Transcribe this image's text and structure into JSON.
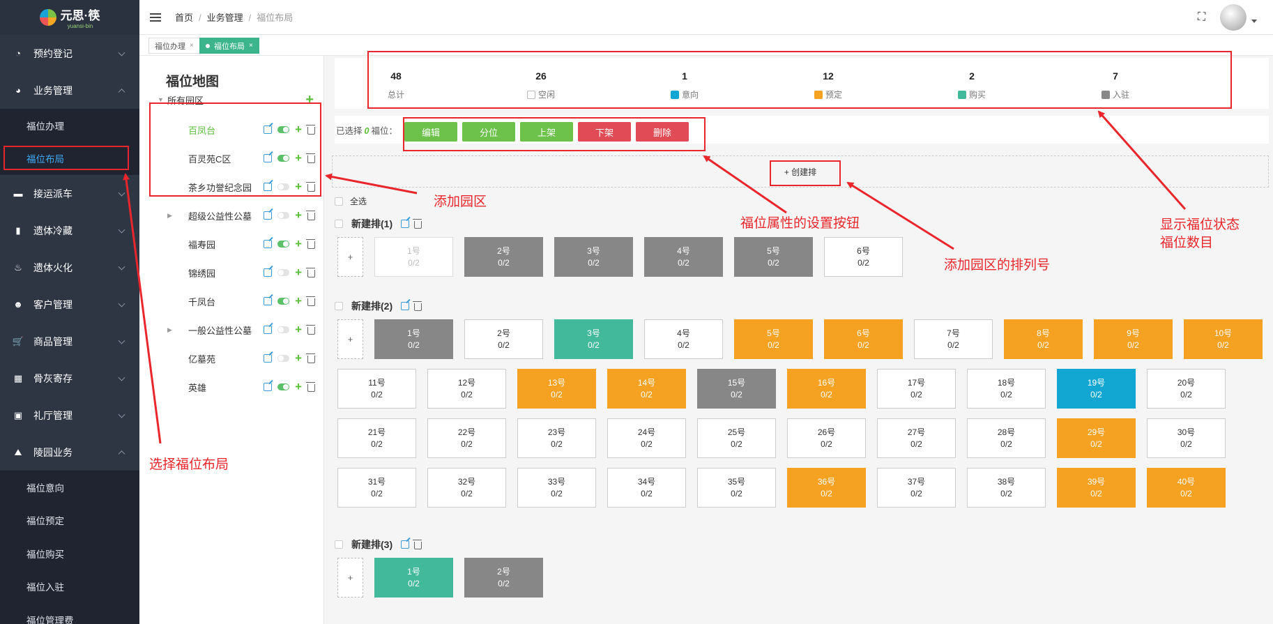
{
  "app": {
    "logo_text": "元思·筷",
    "logo_sub": "yuansi-bin"
  },
  "sidebar": {
    "items": [
      {
        "label": "预约登记",
        "icon": "dashboard-icon"
      },
      {
        "label": "业务管理",
        "icon": "chat-icon",
        "expanded": true,
        "children": [
          "福位办理",
          "福位布局"
        ],
        "active_child": "福位布局"
      },
      {
        "label": "接运派车",
        "icon": "truck-icon"
      },
      {
        "label": "遗体冷藏",
        "icon": "thermometer-icon"
      },
      {
        "label": "遗体火化",
        "icon": "fire-icon"
      },
      {
        "label": "客户管理",
        "icon": "users-icon"
      },
      {
        "label": "商品管理",
        "icon": "cart-icon"
      },
      {
        "label": "骨灰寄存",
        "icon": "grid-icon"
      },
      {
        "label": "礼厅管理",
        "icon": "hall-icon"
      },
      {
        "label": "陵园业务",
        "icon": "cemetery-icon",
        "expanded": true,
        "children": [
          "福位意向",
          "福位预定",
          "福位购买",
          "福位入驻",
          "福位管理费"
        ]
      }
    ]
  },
  "topbar": {
    "breadcrumb": [
      "首页",
      "业务管理",
      "福位布局"
    ]
  },
  "tabs": [
    {
      "label": "福位办理",
      "active": false
    },
    {
      "label": "福位布局",
      "active": true
    }
  ],
  "leftpanel": {
    "title": "福位地图",
    "root": "所有园区",
    "parks": [
      {
        "name": "百凤台",
        "enabled": true,
        "selected": true,
        "has_children": false
      },
      {
        "name": "百灵苑C区",
        "enabled": true,
        "selected": false,
        "has_children": false
      },
      {
        "name": "茶乡功誉纪念园",
        "enabled": false,
        "selected": false,
        "has_children": false
      },
      {
        "name": "超级公益性公墓",
        "enabled": false,
        "selected": false,
        "has_children": true
      },
      {
        "name": "福寿园",
        "enabled": true,
        "selected": false,
        "has_children": false
      },
      {
        "name": "锦绣园",
        "enabled": false,
        "selected": false,
        "has_children": false
      },
      {
        "name": "千凤台",
        "enabled": true,
        "selected": false,
        "has_children": false
      },
      {
        "name": "一般公益性公墓",
        "enabled": false,
        "selected": false,
        "has_children": true
      },
      {
        "name": "亿墓苑",
        "enabled": false,
        "selected": false,
        "has_children": false
      },
      {
        "name": "英雄",
        "enabled": true,
        "selected": false,
        "has_children": false
      }
    ]
  },
  "stats": [
    {
      "value": "48",
      "label": "总计",
      "swatch": null
    },
    {
      "value": "26",
      "label": "空闲",
      "swatch": "#ffffff"
    },
    {
      "value": "1",
      "label": "意向",
      "swatch": "#12a7d3"
    },
    {
      "value": "12",
      "label": "预定",
      "swatch": "#f5a223"
    },
    {
      "value": "2",
      "label": "购买",
      "swatch": "#43b99b"
    },
    {
      "value": "7",
      "label": "入驻",
      "swatch": "#878787"
    }
  ],
  "selection": {
    "prefix": "已选择",
    "count": "0",
    "suffix": "福位："
  },
  "actions": [
    {
      "label": "编辑",
      "color": "green"
    },
    {
      "label": "分位",
      "color": "green"
    },
    {
      "label": "上架",
      "color": "green"
    },
    {
      "label": "下架",
      "color": "red"
    },
    {
      "label": "删除",
      "color": "red"
    }
  ],
  "create_row": "+ 创建排",
  "select_all": "全选",
  "add_tile": "+",
  "rows": [
    {
      "title": "新建排(1)",
      "tiles": [
        {
          "label": "1号",
          "count": "0/2",
          "status": "ghost"
        },
        {
          "label": "2号",
          "count": "0/2",
          "status": "occ"
        },
        {
          "label": "3号",
          "count": "0/2",
          "status": "occ"
        },
        {
          "label": "4号",
          "count": "0/2",
          "status": "occ"
        },
        {
          "label": "5号",
          "count": "0/2",
          "status": "occ"
        },
        {
          "label": "6号",
          "count": "0/2",
          "status": "free"
        }
      ]
    },
    {
      "title": "新建排(2)",
      "tiles": [
        {
          "label": "1号",
          "count": "0/2",
          "status": "occ"
        },
        {
          "label": "2号",
          "count": "0/2",
          "status": "free"
        },
        {
          "label": "3号",
          "count": "0/2",
          "status": "buy"
        },
        {
          "label": "4号",
          "count": "0/2",
          "status": "free"
        },
        {
          "label": "5号",
          "count": "0/2",
          "status": "res"
        },
        {
          "label": "6号",
          "count": "0/2",
          "status": "res"
        },
        {
          "label": "7号",
          "count": "0/2",
          "status": "free"
        },
        {
          "label": "8号",
          "count": "0/2",
          "status": "res"
        },
        {
          "label": "9号",
          "count": "0/2",
          "status": "res"
        },
        {
          "label": "10号",
          "count": "0/2",
          "status": "res"
        },
        {
          "label": "11号",
          "count": "0/2",
          "status": "free"
        },
        {
          "label": "12号",
          "count": "0/2",
          "status": "free"
        },
        {
          "label": "13号",
          "count": "0/2",
          "status": "res"
        },
        {
          "label": "14号",
          "count": "0/2",
          "status": "res"
        },
        {
          "label": "15号",
          "count": "0/2",
          "status": "occ"
        },
        {
          "label": "16号",
          "count": "0/2",
          "status": "res"
        },
        {
          "label": "17号",
          "count": "0/2",
          "status": "free"
        },
        {
          "label": "18号",
          "count": "0/2",
          "status": "free"
        },
        {
          "label": "19号",
          "count": "0/2",
          "status": "int"
        },
        {
          "label": "20号",
          "count": "0/2",
          "status": "free"
        },
        {
          "label": "21号",
          "count": "0/2",
          "status": "free"
        },
        {
          "label": "22号",
          "count": "0/2",
          "status": "free"
        },
        {
          "label": "23号",
          "count": "0/2",
          "status": "free"
        },
        {
          "label": "24号",
          "count": "0/2",
          "status": "free"
        },
        {
          "label": "25号",
          "count": "0/2",
          "status": "free"
        },
        {
          "label": "26号",
          "count": "0/2",
          "status": "free"
        },
        {
          "label": "27号",
          "count": "0/2",
          "status": "free"
        },
        {
          "label": "28号",
          "count": "0/2",
          "status": "free"
        },
        {
          "label": "29号",
          "count": "0/2",
          "status": "res"
        },
        {
          "label": "30号",
          "count": "0/2",
          "status": "free"
        },
        {
          "label": "31号",
          "count": "0/2",
          "status": "free"
        },
        {
          "label": "32号",
          "count": "0/2",
          "status": "free"
        },
        {
          "label": "33号",
          "count": "0/2",
          "status": "free"
        },
        {
          "label": "34号",
          "count": "0/2",
          "status": "free"
        },
        {
          "label": "35号",
          "count": "0/2",
          "status": "free"
        },
        {
          "label": "36号",
          "count": "0/2",
          "status": "res"
        },
        {
          "label": "37号",
          "count": "0/2",
          "status": "free"
        },
        {
          "label": "38号",
          "count": "0/2",
          "status": "free"
        },
        {
          "label": "39号",
          "count": "0/2",
          "status": "res"
        },
        {
          "label": "40号",
          "count": "0/2",
          "status": "res"
        }
      ]
    },
    {
      "title": "新建排(3)",
      "tiles": [
        {
          "label": "1号",
          "count": "0/2",
          "status": "buy"
        },
        {
          "label": "2号",
          "count": "0/2",
          "status": "occ"
        }
      ]
    }
  ],
  "annotations": {
    "add_park": "添加园区",
    "select_layout": "选择福位布局",
    "settings_buttons": "福位属性的设置按钮",
    "add_row_number": "添加园区的排列号",
    "status_line1": "显示福位状态",
    "status_line2": "福位数目"
  },
  "colors": {
    "free": "#ffffff",
    "intent": "#12a7d3",
    "reserved": "#f5a223",
    "bought": "#43b99b",
    "occupied": "#878787",
    "annotation": "#e8262b"
  }
}
